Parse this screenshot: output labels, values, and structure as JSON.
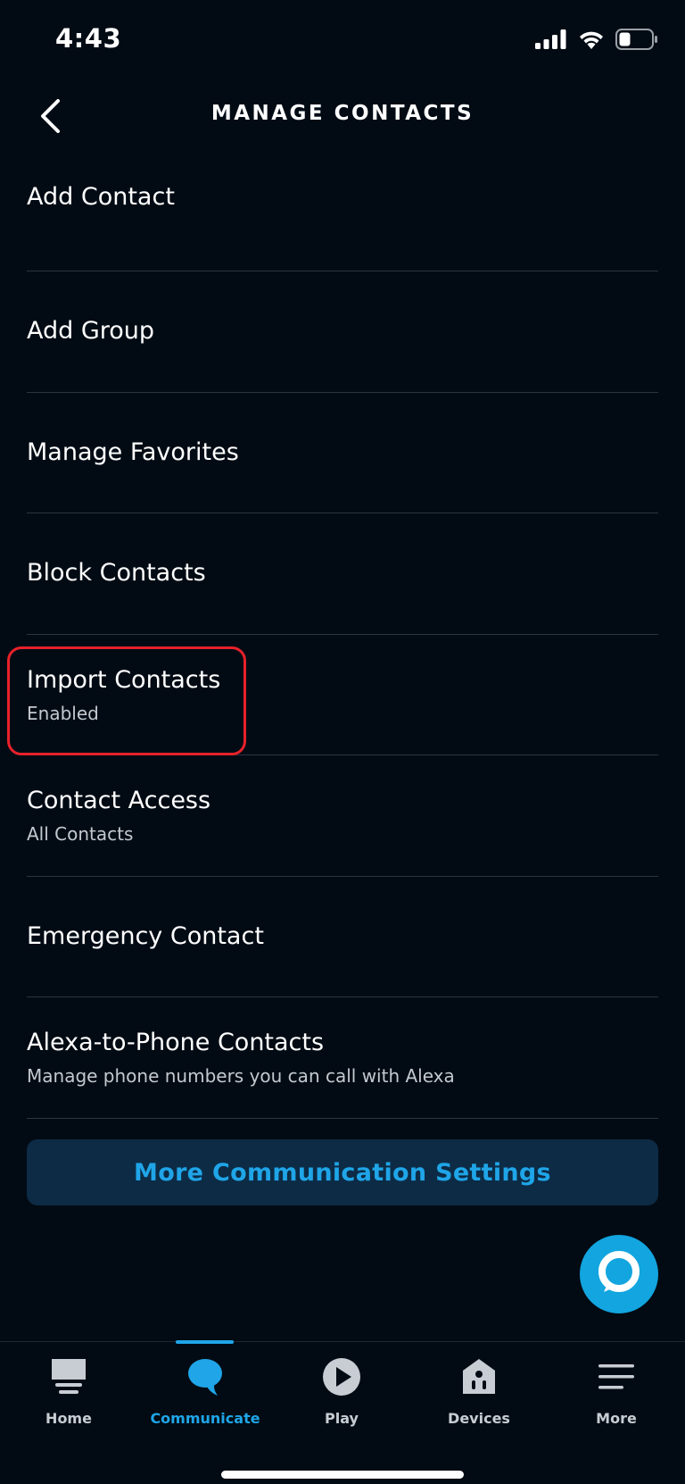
{
  "status_bar": {
    "time": "4:43",
    "icons": [
      "cellular-signal-icon",
      "wifi-icon",
      "battery-icon"
    ]
  },
  "header": {
    "title": "MANAGE CONTACTS",
    "back_icon": "chevron-left-icon"
  },
  "menu": {
    "items": [
      {
        "title": "Add Contact",
        "subtitle": ""
      },
      {
        "title": "Add Group",
        "subtitle": ""
      },
      {
        "title": "Manage Favorites",
        "subtitle": ""
      },
      {
        "title": "Block Contacts",
        "subtitle": ""
      },
      {
        "title": "Import Contacts",
        "subtitle": "Enabled"
      },
      {
        "title": "Contact Access",
        "subtitle": "All Contacts"
      },
      {
        "title": "Emergency Contact",
        "subtitle": ""
      },
      {
        "title": "Alexa-to-Phone Contacts",
        "subtitle": "Manage phone numbers you can call with Alexa"
      }
    ]
  },
  "actions": {
    "more_settings_label": "More Communication Settings"
  },
  "alexa_button": {
    "icon": "alexa-ring-icon"
  },
  "bottom_nav": {
    "active": "Communicate",
    "items": [
      {
        "label": "Home",
        "icon": "home-icon"
      },
      {
        "label": "Communicate",
        "icon": "chat-bubble-icon"
      },
      {
        "label": "Play",
        "icon": "play-icon"
      },
      {
        "label": "Devices",
        "icon": "devices-house-icon"
      },
      {
        "label": "More",
        "icon": "menu-lines-icon"
      }
    ]
  },
  "colors": {
    "background": "#020b14",
    "accent": "#1fa5e8",
    "button_bg": "#0d2b45",
    "highlight": "#e8212b",
    "alexa_blue": "#12a5df"
  }
}
